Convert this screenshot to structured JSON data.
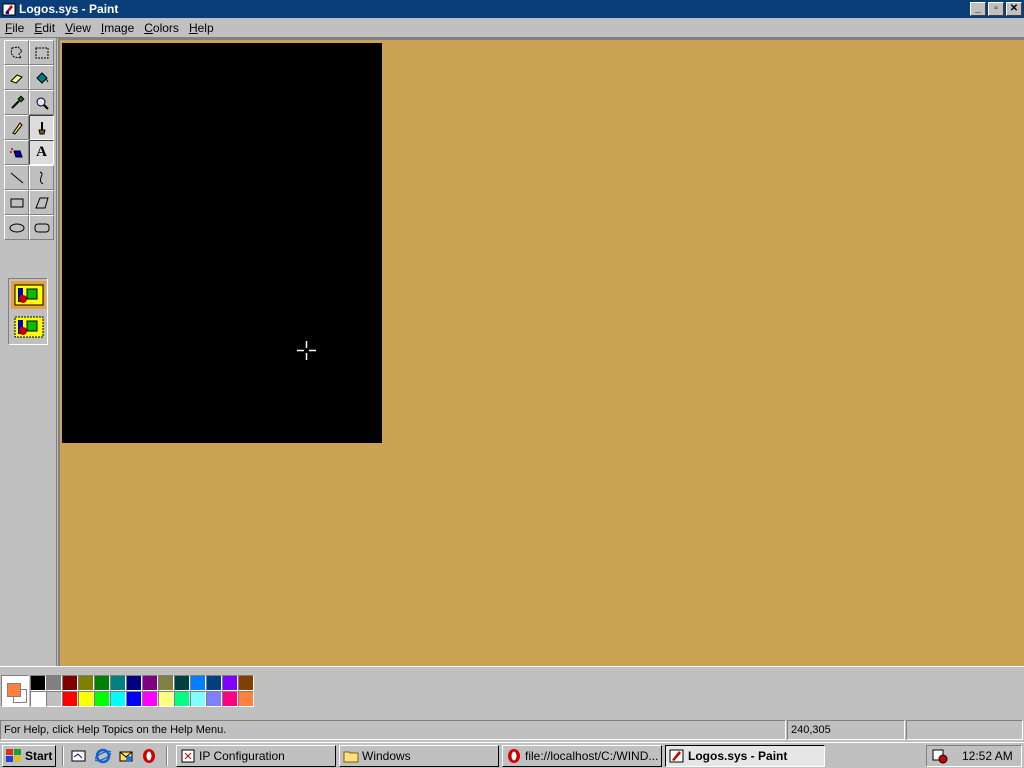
{
  "window": {
    "title": "Logos.sys - Paint",
    "buttons": {
      "minimize": "_",
      "maximize": "▫",
      "close": "✕"
    }
  },
  "menu": [
    {
      "key": "F",
      "rest": "ile"
    },
    {
      "key": "E",
      "rest": "dit"
    },
    {
      "key": "V",
      "rest": "iew"
    },
    {
      "key": "I",
      "rest": "mage"
    },
    {
      "key": "C",
      "rest": "olors"
    },
    {
      "key": "H",
      "rest": "elp"
    }
  ],
  "toolbox": {
    "tools": [
      {
        "name": "free-form-select",
        "icon": "freeform-select-icon"
      },
      {
        "name": "select",
        "icon": "rect-select-icon"
      },
      {
        "name": "eraser",
        "icon": "eraser-icon"
      },
      {
        "name": "fill",
        "icon": "fill-bucket-icon"
      },
      {
        "name": "pick-color",
        "icon": "eyedropper-icon"
      },
      {
        "name": "magnifier",
        "icon": "magnifier-icon"
      },
      {
        "name": "pencil",
        "icon": "pencil-icon"
      },
      {
        "name": "brush",
        "icon": "brush-icon"
      },
      {
        "name": "airbrush",
        "icon": "airbrush-icon"
      },
      {
        "name": "text",
        "icon": "text-icon",
        "glyph": "A"
      },
      {
        "name": "line",
        "icon": "line-icon"
      },
      {
        "name": "curve",
        "icon": "curve-icon"
      },
      {
        "name": "rectangle",
        "icon": "rectangle-icon"
      },
      {
        "name": "polygon",
        "icon": "polygon-icon"
      },
      {
        "name": "ellipse",
        "icon": "ellipse-icon"
      },
      {
        "name": "rounded-rectangle",
        "icon": "rounded-rect-icon"
      }
    ],
    "selected_tool": "text"
  },
  "canvas": {
    "background": "#cca352",
    "image_color": "#000000"
  },
  "colors": {
    "foreground": "#ff8040",
    "background": "#ffffff",
    "palette_top": [
      "#000000",
      "#808080",
      "#800000",
      "#808000",
      "#008000",
      "#008080",
      "#000080",
      "#800080",
      "#808040",
      "#004040",
      "#0080ff",
      "#004080",
      "#8000ff",
      "#804000"
    ],
    "palette_bottom": [
      "#ffffff",
      "#c0c0c0",
      "#ff0000",
      "#ffff00",
      "#00ff00",
      "#00ffff",
      "#0000ff",
      "#ff00ff",
      "#ffff80",
      "#00ff80",
      "#80ffff",
      "#8080ff",
      "#ff0080",
      "#ff8040"
    ]
  },
  "status": {
    "help_text": "For Help, click Help Topics on the Help Menu.",
    "coords": "240,305",
    "size": ""
  },
  "taskbar": {
    "start_label": "Start",
    "tasks": [
      {
        "label": "IP Configuration",
        "icon": "ip-config-icon"
      },
      {
        "label": "Windows",
        "icon": "folder-icon"
      },
      {
        "label": "file://localhost/C:/WIND...",
        "icon": "opera-icon"
      },
      {
        "label": "Logos.sys - Paint",
        "icon": "paint-icon",
        "active": true
      }
    ],
    "clock": "12:52 AM"
  }
}
